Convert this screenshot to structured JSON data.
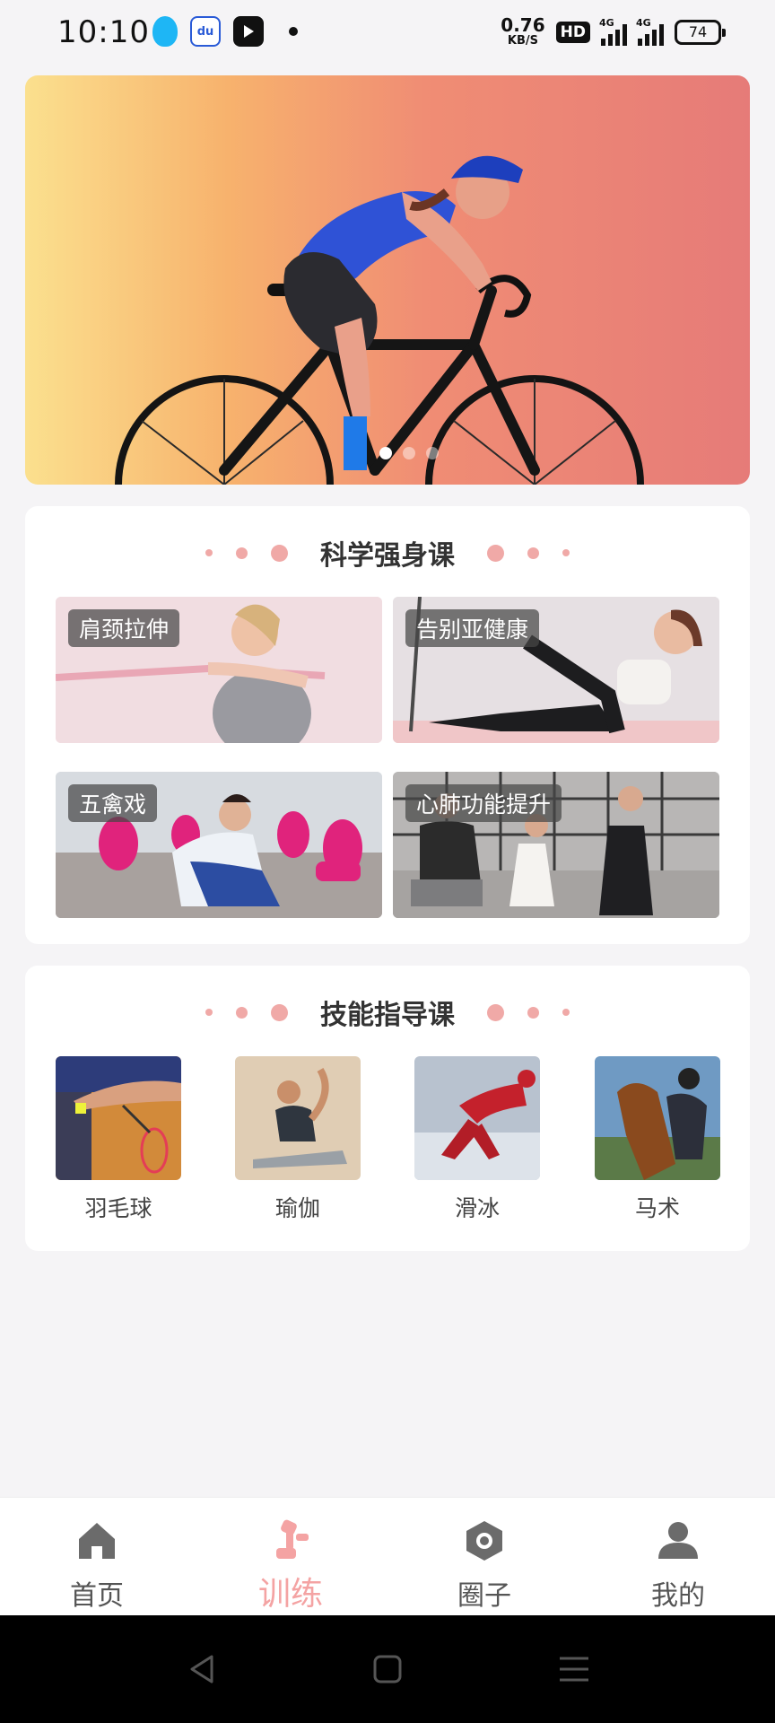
{
  "status_bar": {
    "time": "10:10",
    "net_speed_value": "0.76",
    "net_speed_unit": "KB/S",
    "hd_badge": "HD",
    "signal1_label": "4G",
    "signal2_label": "4G",
    "battery": "74"
  },
  "banner": {
    "slide_count": 3,
    "active_slide": 1
  },
  "section_fitness": {
    "title": "科学强身课",
    "items": [
      {
        "label": "肩颈拉伸"
      },
      {
        "label": "告别亚健康"
      },
      {
        "label": "五禽戏"
      },
      {
        "label": "心肺功能提升"
      }
    ]
  },
  "section_skills": {
    "title": "技能指导课",
    "items": [
      {
        "label": "羽毛球"
      },
      {
        "label": "瑜伽"
      },
      {
        "label": "滑冰"
      },
      {
        "label": "马术"
      }
    ]
  },
  "tab_bar": {
    "tabs": [
      {
        "label": "首页",
        "icon": "home-icon"
      },
      {
        "label": "训练",
        "icon": "dumbbell-icon",
        "active": true
      },
      {
        "label": "圈子",
        "icon": "camera-icon"
      },
      {
        "label": "我的",
        "icon": "person-icon"
      }
    ]
  },
  "colors": {
    "accent": "#f4a3a3",
    "deco_dot": "#f0a9a7",
    "background": "#f5f4f6"
  }
}
